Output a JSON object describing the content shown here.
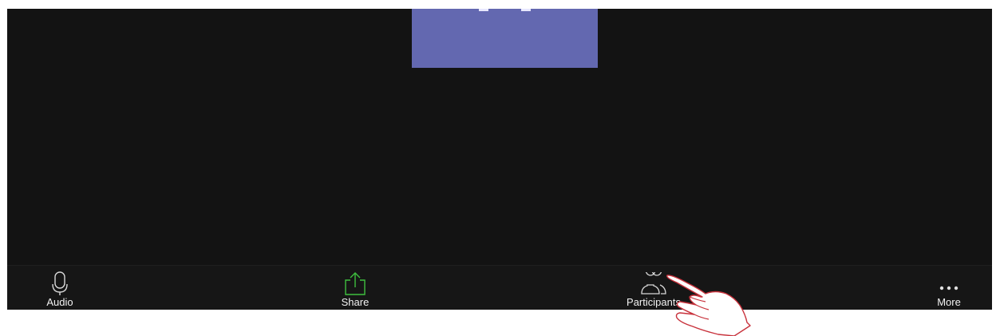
{
  "meeting": {
    "toolbar": {
      "items": [
        {
          "label": "Audio",
          "icon": "microphone-icon"
        },
        {
          "label": "Share",
          "icon": "share-upload-icon",
          "icon_color": "#3fbf3f"
        },
        {
          "label": "Participants",
          "icon": "participants-icon"
        },
        {
          "label": "More",
          "icon": "more-dots-icon"
        }
      ]
    }
  },
  "colors": {
    "background": "#131313",
    "video_tile": "#6368b0",
    "share_accent": "#3fbf3f",
    "pointer_hand": "#c8323c"
  },
  "overlay": {
    "icon": "pointing-hand-icon"
  }
}
